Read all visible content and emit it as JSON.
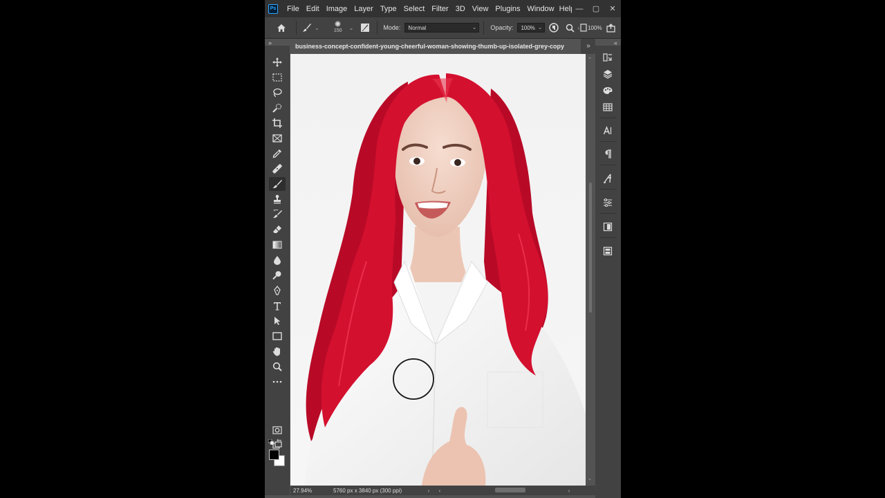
{
  "app": {
    "logo": "Ps",
    "menu": [
      "File",
      "Edit",
      "Image",
      "Layer",
      "Type",
      "Select",
      "Filter",
      "3D",
      "View",
      "Plugins",
      "Window",
      "Help"
    ],
    "window_controls": [
      "—",
      "▢",
      "✕"
    ]
  },
  "options": {
    "brush_size": "150",
    "mode_label": "Mode:",
    "mode_value": "Normal",
    "opacity_label": "Opacity:",
    "opacity_value": "100%",
    "flow_value": "100%"
  },
  "document": {
    "tab_title": "business-concept-confident-young-cheerful-woman-showing-thumb-up-isolated-grey-copy",
    "tab_arrows": "»"
  },
  "status": {
    "zoom": "27.94%",
    "info": "5760 px x 3840 px (300 ppi)",
    "arrow": "›",
    "left_arrow": "‹",
    "right_arrow": "›"
  },
  "colors": {
    "foreground": "#000000",
    "background": "#ffffff",
    "hair": "#d4102f",
    "app_bg": "#535353",
    "panel_bg": "#424242",
    "menubar_bg": "#323232"
  },
  "tools": [
    "move-icon",
    "marquee-icon",
    "lasso-icon",
    "quick-select-icon",
    "crop-icon",
    "frame-icon",
    "eyedropper-icon",
    "healing-icon",
    "brush-icon",
    "stamp-icon",
    "history-brush-icon",
    "eraser-icon",
    "gradient-icon",
    "blur-icon",
    "dodge-icon",
    "pen-icon",
    "type-icon",
    "path-select-icon",
    "rectangle-icon",
    "hand-icon",
    "zoom-icon",
    "more-icon"
  ]
}
